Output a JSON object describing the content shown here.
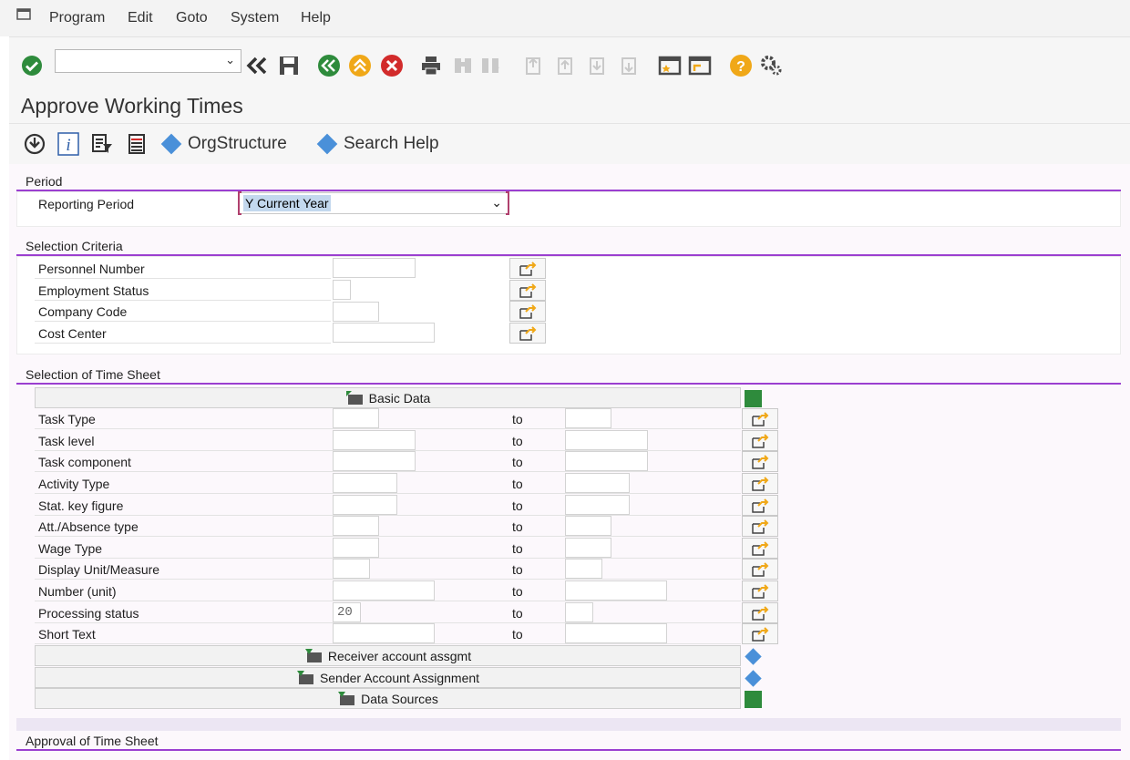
{
  "menu": {
    "items": [
      {
        "label": "Program"
      },
      {
        "label": "Edit"
      },
      {
        "label": "Goto"
      },
      {
        "label": "System"
      },
      {
        "label": "Help"
      }
    ]
  },
  "toolbar": {
    "command_value": "",
    "icons": [
      "enter-icon",
      "back-double-icon",
      "save-icon",
      "back-icon",
      "exit-icon",
      "cancel-icon",
      "print-icon",
      "find-icon",
      "find-next-icon",
      "first-page-icon",
      "previous-page-icon",
      "next-page-icon",
      "last-page-icon",
      "create-session-icon",
      "shortcut-icon",
      "help-icon",
      "settings-icon"
    ],
    "colors": {
      "green": "#2e8b3c",
      "amber": "#f0a818",
      "red": "#d22b2b",
      "grey": "#4a4a4a"
    }
  },
  "page": {
    "title": "Approve Working Times"
  },
  "app_toolbar": {
    "icons": [
      "execute-icon",
      "info-icon",
      "variant-icon",
      "list-icon"
    ],
    "org_structure": "OrgStructure",
    "search_help": "Search Help"
  },
  "period": {
    "header": "Period",
    "label": "Reporting Period",
    "value": "Y Current Year"
  },
  "selection_criteria": {
    "header": "Selection Criteria",
    "rows": [
      {
        "label": "Personnel Number",
        "value": ""
      },
      {
        "label": "Employment Status",
        "value": ""
      },
      {
        "label": "Company Code",
        "value": ""
      },
      {
        "label": "Cost Center",
        "value": ""
      }
    ]
  },
  "time_sheet": {
    "header": "Selection of Time Sheet",
    "basic_data": "Basic Data",
    "to_label": "to",
    "rows": [
      {
        "label": "Task Type",
        "from": "",
        "to": ""
      },
      {
        "label": "Task level",
        "from": "",
        "to": ""
      },
      {
        "label": "Task component",
        "from": "",
        "to": ""
      },
      {
        "label": "Activity Type",
        "from": "",
        "to": ""
      },
      {
        "label": "Stat. key figure",
        "from": "",
        "to": ""
      },
      {
        "label": "Att./Absence type",
        "from": "",
        "to": ""
      },
      {
        "label": "Wage Type",
        "from": "",
        "to": ""
      },
      {
        "label": "Display Unit/Measure",
        "from": "",
        "to": ""
      },
      {
        "label": "Number (unit)",
        "from": "",
        "to": ""
      },
      {
        "label": "Processing status",
        "from": "20",
        "to": ""
      },
      {
        "label": "Short Text",
        "from": "",
        "to": ""
      }
    ],
    "sections": [
      {
        "label": "Receiver account assgmt"
      },
      {
        "label": "Sender Account Assignment"
      },
      {
        "label": "Data Sources"
      }
    ]
  },
  "approval": {
    "header": "Approval of Time Sheet"
  }
}
